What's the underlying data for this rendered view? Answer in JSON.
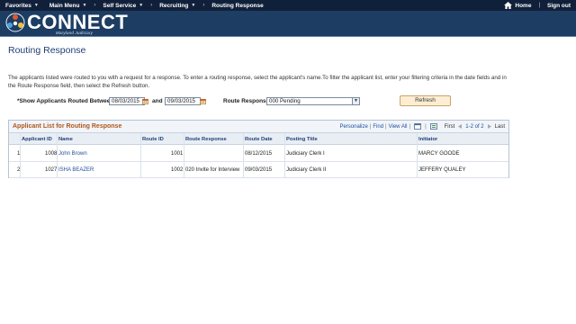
{
  "topnav": {
    "favorites": "Favorites",
    "main_menu": "Main Menu",
    "breadcrumbs": [
      "Self Service",
      "Recruiting",
      "Routing Response"
    ],
    "home": "Home",
    "sign_out": "Sign out"
  },
  "header": {
    "logo_text": "CONNECT",
    "logo_sub": "Maryland Judiciary"
  },
  "page": {
    "title": "Routing Response",
    "instructions": "The applicants listed were routed to you with a request for a response. To enter a routing response, select the applicant's name.To filter the applicant list, enter your filtering criteria in the date fields and in the Route Response field, then select the Refresh button."
  },
  "filters": {
    "show_label": "*Show Applicants Routed Between",
    "date_from": "08/03/2015",
    "and_label": "and",
    "date_to": "09/03/2015",
    "route_response_label": "Route Response",
    "route_response_value": "000 Pending",
    "refresh_label": "Refresh"
  },
  "grid": {
    "title": "Applicant List for Routing Response",
    "personalize": "Personalize",
    "find": "Find",
    "view_all": "View All",
    "first": "First",
    "range": "1-2 of 2",
    "last": "Last",
    "columns": [
      "Applicant ID",
      "Name",
      "Route ID",
      "Route Response",
      "Route Date",
      "Posting Title",
      "Initiator"
    ],
    "rows": [
      {
        "num": "1",
        "applicant_id": "1008",
        "name": "John Brown",
        "route_id": "1001",
        "route_response": "",
        "route_date": "08/12/2015",
        "posting_title": "Judiciary Clerk I",
        "initiator": "MARCY GOODE"
      },
      {
        "num": "2",
        "applicant_id": "1027",
        "name": "ISHA BEAZER",
        "route_id": "1002",
        "route_response": "020 Invite for Interview",
        "route_date": "09/03/2015",
        "posting_title": "Judiciary Clerk II",
        "initiator": "JEFFERY QUALEY"
      }
    ]
  },
  "colors": {
    "nav_bg": "#11203a",
    "header_bg": "#1d3d63",
    "title_color": "#1f3f75",
    "grid_title": "#b0571e",
    "link": "#1f4e9c"
  },
  "icons": [
    "home-icon",
    "calendar-icon",
    "zoom-icon",
    "download-icon",
    "first-arrow-icon",
    "last-arrow-icon",
    "dropdown-arrow-icon"
  ]
}
